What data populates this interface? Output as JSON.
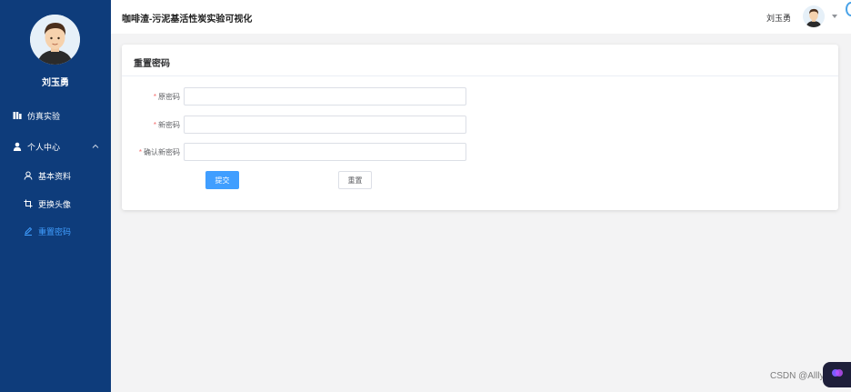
{
  "app": {
    "title": "咖啡渣-污泥基活性炭实验可视化"
  },
  "sidebar": {
    "username": "刘玉勇",
    "items": [
      {
        "label": "仿真实验",
        "icon": "chart-icon"
      },
      {
        "label": "个人中心",
        "icon": "user-icon"
      }
    ],
    "sub_items": [
      {
        "label": "基本资料",
        "icon": "user-outline-icon"
      },
      {
        "label": "更换头像",
        "icon": "crop-icon"
      },
      {
        "label": "重置密码",
        "icon": "edit-icon",
        "active": true
      }
    ]
  },
  "header": {
    "username": "刘玉勇"
  },
  "form": {
    "title": "重置密码",
    "required_mark": "*",
    "fields": [
      {
        "label": "原密码",
        "value": ""
      },
      {
        "label": "新密码",
        "value": ""
      },
      {
        "label": "确认新密码",
        "value": ""
      }
    ],
    "submit_label": "提交",
    "reset_label": "重置"
  },
  "watermark": "CSDN @Alllyn",
  "colors": {
    "sidebar": "#0e3c7b",
    "accent": "#409eff",
    "required": "#f56c6c"
  }
}
